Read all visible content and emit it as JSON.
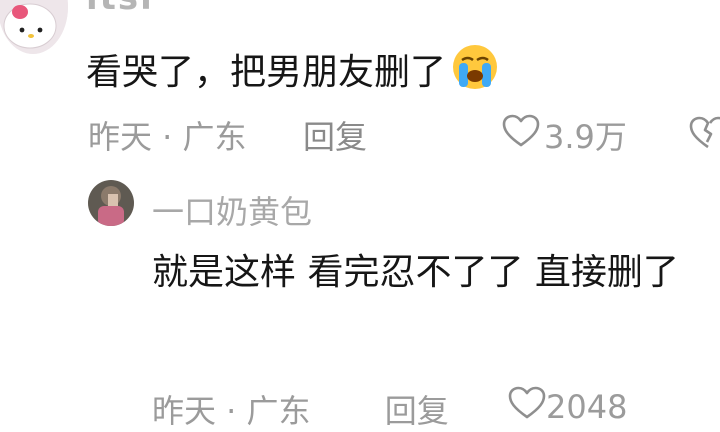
{
  "top_comment": {
    "username_partial": "itsl",
    "text": "看哭了，把男朋友删了",
    "emoji": "loudly-crying-face-emoji",
    "time_location": "昨天 · 广东",
    "reply_label": "回复",
    "like_count": "3.9万",
    "icons": {
      "like": "heart-outline-icon",
      "dislike": "broken-heart-icon"
    }
  },
  "reply": {
    "username": "一口奶黄包",
    "text": "就是这样 看完忍不了了 直接删了",
    "time_location": "昨天 · 广东",
    "reply_label": "回复",
    "like_count": "2048"
  },
  "colors": {
    "text": "#161616",
    "meta": "#9b9b9b",
    "background": "#ffffff"
  }
}
